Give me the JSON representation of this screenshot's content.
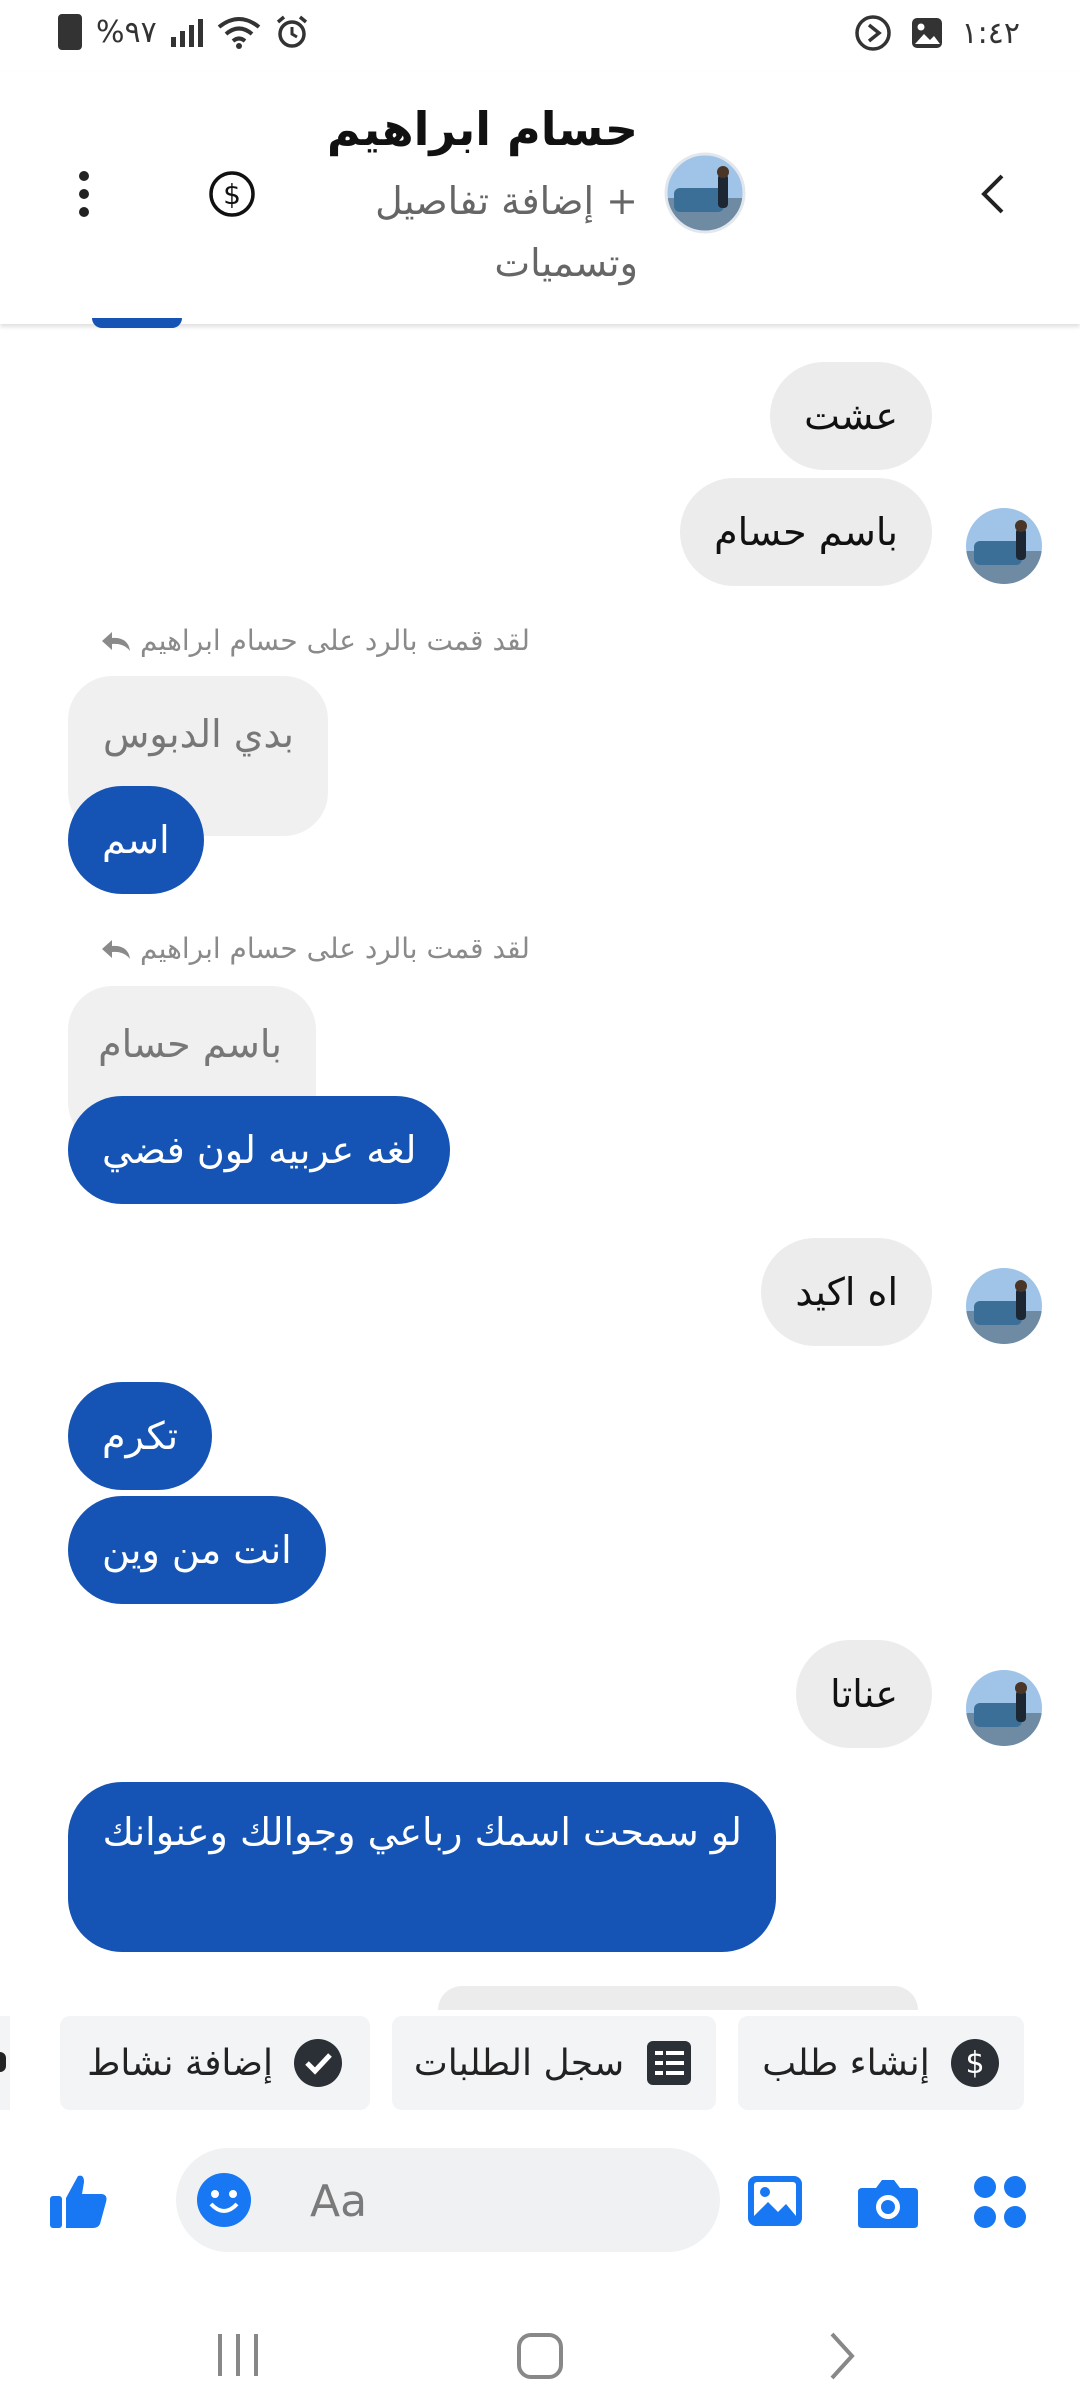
{
  "status_bar": {
    "battery": "%٩٧",
    "time": "١:٤٢"
  },
  "header": {
    "name": "حسام ابراهيم",
    "subtitle": "+ إضافة تفاصيل وتسميات",
    "icons": [
      "chevron-left-icon",
      "avatar",
      "dollar-icon",
      "more-vertical-icon"
    ]
  },
  "messages": [
    {
      "side": "in",
      "text": "عشت"
    },
    {
      "side": "in",
      "text": "باسم حسام"
    },
    {
      "side": "out",
      "reply_label": "لقد قمت بالرد على حسام ابراهيم",
      "quoted": "بدي الدبوس",
      "text": "اسم"
    },
    {
      "side": "out",
      "reply_label": "لقد قمت بالرد على حسام ابراهيم",
      "quoted": "باسم حسام",
      "text": "لغه عربيه لون فضي"
    },
    {
      "side": "in",
      "text": "اه اكيد"
    },
    {
      "side": "out",
      "text": "تكرم"
    },
    {
      "side": "out",
      "text": "انت من وين"
    },
    {
      "side": "in",
      "text": "عناتا"
    },
    {
      "side": "out",
      "text": "لو سمحت اسمك رباعي وجوالك وعنوانك"
    }
  ],
  "quick_actions": [
    {
      "label": "إنشاء طلب",
      "icon": "dollar-circle-icon"
    },
    {
      "label": "سجل الطلبات",
      "icon": "list-icon"
    },
    {
      "label": "إضافة نشاط",
      "icon": "check-circle-icon"
    }
  ],
  "composer": {
    "placeholder": "Aa",
    "icons": [
      "apps-icon",
      "camera-icon",
      "gallery-icon",
      "emoji-icon",
      "like-icon"
    ]
  },
  "colors": {
    "outgoing": "#1554b5",
    "incoming": "#ececec",
    "accent": "#1877f2"
  }
}
